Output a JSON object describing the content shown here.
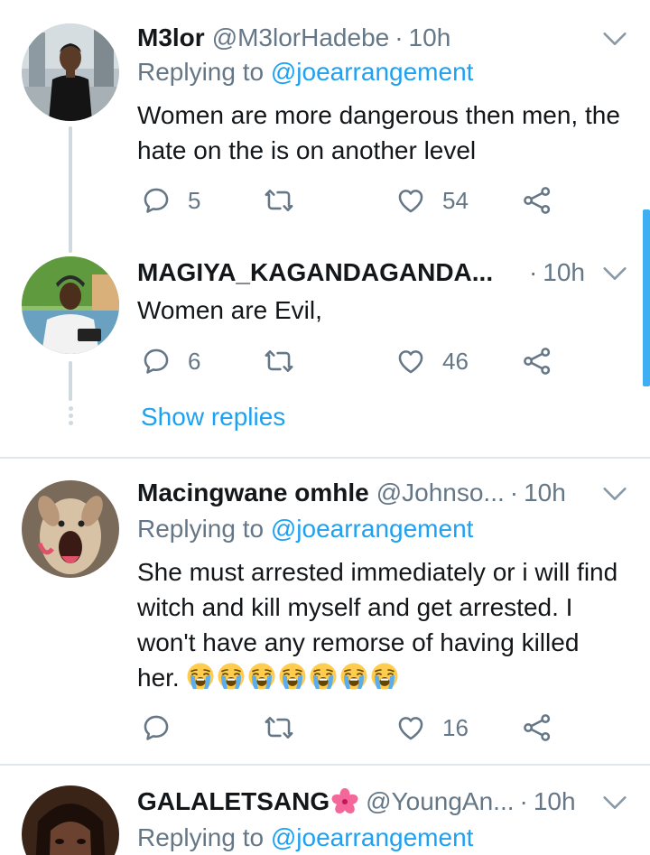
{
  "tweets": [
    {
      "name": "M3lor",
      "handle": "@M3lorHadebe",
      "time": "10h",
      "replying_label": "Replying to",
      "replying_to": "@joearrangement",
      "text": "Women are more dangerous then men, the hate on the is on another level",
      "replies": "5",
      "likes": "54"
    },
    {
      "name": "MAGIYA_KAGANDAGANDA...",
      "time": "10h",
      "text": "Women are Evil,",
      "replies": "6",
      "likes": "46",
      "show_replies": "Show replies"
    },
    {
      "name": "Macingwane omhle",
      "handle": "@Johnso...",
      "time": "10h",
      "replying_label": "Replying to",
      "replying_to": "@joearrangement",
      "text": "She must arrested immediately or i will find witch and kill myself and get arrested. I won't have any remorse of having killed her.",
      "emoji_count": 7,
      "likes": "16"
    },
    {
      "name": "GALALETSANG",
      "handle": "@YoungAn...",
      "time": "10h",
      "replying_label": "Replying to",
      "replying_to": "@joearrangement"
    }
  ],
  "separator": "·",
  "icons": {
    "reply": "reply-icon",
    "retweet": "retweet-icon",
    "like": "heart-icon",
    "share": "share-icon",
    "menu": "chevron-down-icon",
    "emoji": "loudly-crying-face-emoji",
    "flower": "hibiscus-emoji"
  },
  "colors": {
    "accent": "#1da1f2",
    "muted": "#657786",
    "text": "#14171a",
    "divider": "#e1e8ed"
  }
}
